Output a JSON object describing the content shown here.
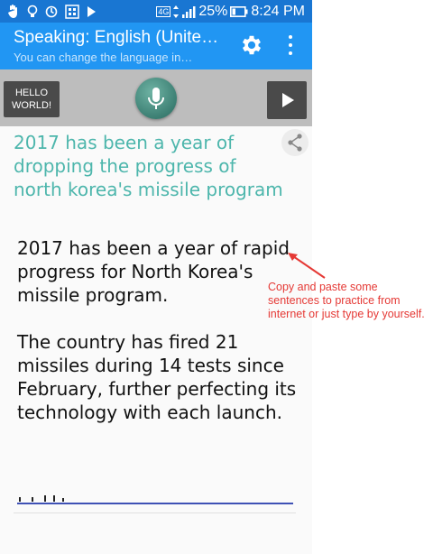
{
  "status_bar": {
    "network": "4G",
    "battery": "25%",
    "time": "8:24 PM"
  },
  "app_bar": {
    "title": "Speaking: English (Unite…",
    "subtitle": "You can change the language in…"
  },
  "controls": {
    "hello_label_line1": "HELLO",
    "hello_label_line2": "WORLD!"
  },
  "recognized_text": "2017 has been a year of dropping the progress of north korea's missile program",
  "input_text": "2017 has been a year of rapid progress for North Korea's missile program.\n\nThe country has fired 21 missiles during 14 tests since February, further perfecting its technology with each launch.",
  "annotation": "Copy and paste some sentences to practice from internet or just type by yourself.",
  "colors": {
    "status_bar": "#1976d2",
    "app_bar": "#2196f3",
    "controls_bg": "#bdbdbd",
    "recognized_text": "#4db6ac",
    "annotation": "#e53935",
    "input_underline": "#3f51b5"
  },
  "icons": [
    "hand-icon",
    "bulb-icon",
    "sync-icon",
    "qr-icon",
    "play-notification-icon",
    "signal-icon",
    "battery-icon",
    "gear-icon",
    "more-vert-icon",
    "mic-icon",
    "play-icon",
    "share-icon",
    "arrow-icon"
  ]
}
